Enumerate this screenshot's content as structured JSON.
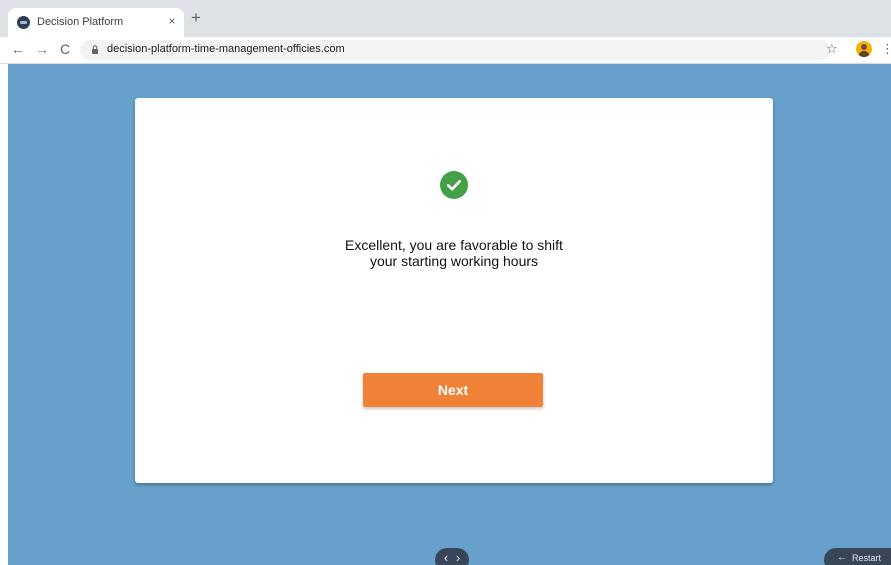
{
  "browser": {
    "tab": {
      "title": "Decision Platform",
      "close_glyph": "×",
      "favicon": "decision-platform-favicon"
    },
    "new_tab_glyph": "+",
    "nav": {
      "back_glyph": "←",
      "forward_glyph": "→",
      "reload_glyph": "C"
    },
    "url": "decision-platform-time-management-officies.com",
    "bookmark_glyph": "☆",
    "menu_glyph": "⋮"
  },
  "main": {
    "message_line1": "Excellent, you are favorable to shift",
    "message_line2": "your starting working hours",
    "next_label": "Next"
  },
  "footer": {
    "prev_glyph": "‹",
    "next_glyph": "›",
    "restart_glyph": "←",
    "restart_label": "Restart"
  },
  "icons": {
    "success": "check-circle-icon",
    "lock": "lock-icon",
    "star": "star-icon",
    "avatar": "avatar"
  },
  "colors": {
    "page_background": "#66a0cb",
    "card": "#ffffff",
    "success_green": "#43a047",
    "next_button": "#f08238",
    "pill": "#384658",
    "tab_strip": "#dee1e6"
  }
}
